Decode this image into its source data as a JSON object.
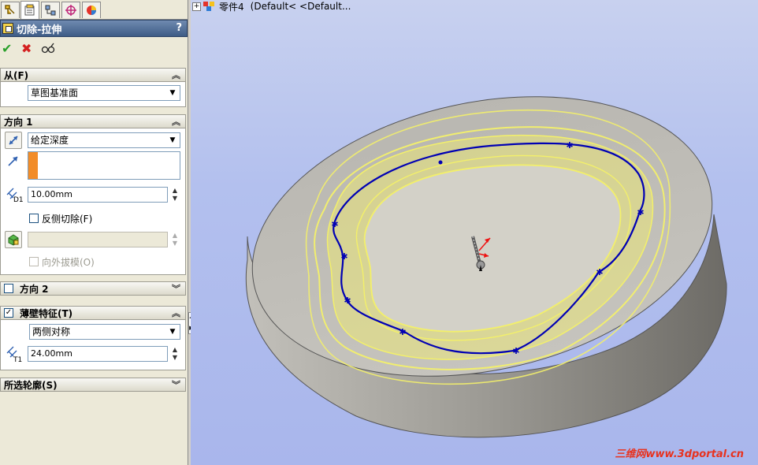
{
  "property_manager": {
    "tabs": [
      "feature-manager",
      "property-manager",
      "configuration-manager",
      "dimxpert-manager",
      "display-manager"
    ],
    "title": "切除-拉伸",
    "help": "?",
    "actions": {
      "ok": "✔",
      "cancel": "✖",
      "preview": "60"
    },
    "from": {
      "header": "从(F)",
      "select": "草图基准面"
    },
    "direction1": {
      "header": "方向 1",
      "end_condition": "给定深度",
      "depth": "10.00mm",
      "depth_symbol": "D1",
      "flip_side_cut": "反侧切除(F)",
      "draft_outward": "向外拔模(O)"
    },
    "direction2": {
      "header": "方向 2"
    },
    "thin_feature": {
      "header": "薄壁特征(T)",
      "type": "两侧对称",
      "thickness": "24.00mm",
      "thickness_symbol": "T1"
    },
    "selected_contours": {
      "header": "所选轮廓(S)"
    }
  },
  "viewport": {
    "tree_part": "零件4",
    "tree_config": "(Default< <Default...",
    "watermark": "三维网www.3dportal.cn"
  },
  "colors": {
    "title_bar": "#3e5c86",
    "viewport_bg": "#b3c0ee",
    "sketch_line": "#0000b4",
    "preview": "#f3f06a",
    "accent_orange": "#f28c28"
  }
}
